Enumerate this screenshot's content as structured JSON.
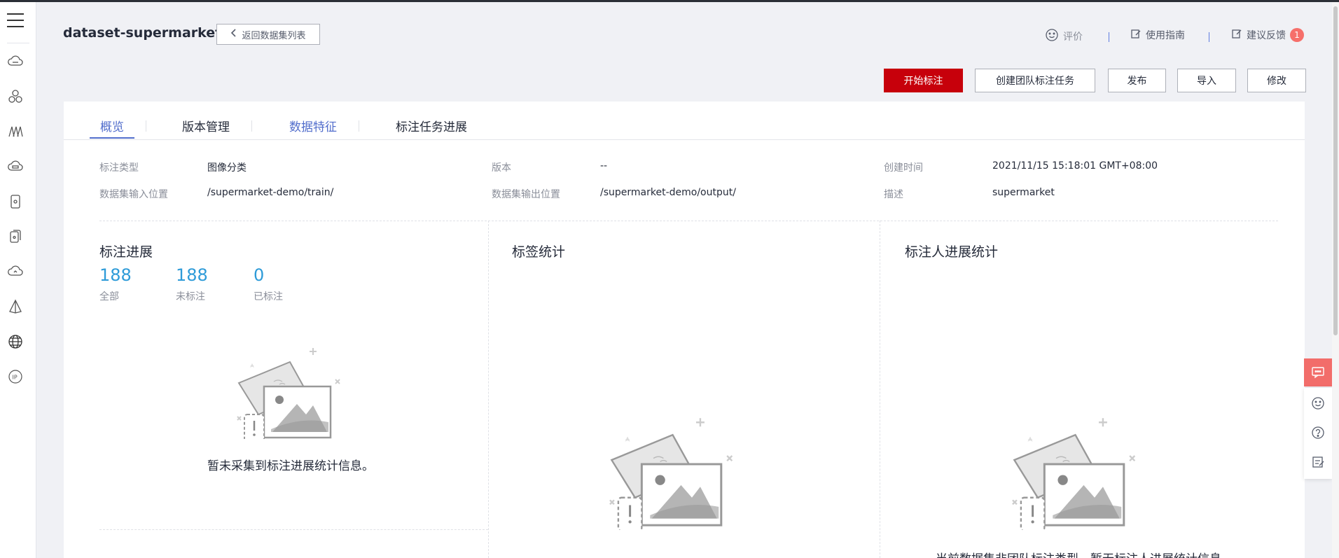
{
  "header": {
    "title": "dataset-supermarket",
    "back_label": "返回数据集列表",
    "rate_label": "评价",
    "guide_label": "使用指南",
    "feedback_label": "建议反馈",
    "feedback_count": "1"
  },
  "actions": {
    "start_label": "开始标注",
    "team_label": "创建团队标注任务",
    "publish_label": "发布",
    "import_label": "导入",
    "edit_label": "修改"
  },
  "tabs": [
    {
      "label": "概览"
    },
    {
      "label": "版本管理"
    },
    {
      "label": "数据特征"
    },
    {
      "label": "标注任务进展"
    }
  ],
  "info": {
    "type_label": "标注类型",
    "type_value": "图像分类",
    "version_label": "版本",
    "version_value": "--",
    "created_label": "创建时间",
    "created_value": "2021/11/15 15:18:01 GMT+08:00",
    "input_label": "数据集输入位置",
    "input_value": "/supermarket-demo/train/",
    "output_label": "数据集输出位置",
    "output_value": "/supermarket-demo/output/",
    "desc_label": "描述",
    "desc_value": "supermarket"
  },
  "progress": {
    "title": "标注进展",
    "stats": [
      {
        "value": "188",
        "label": "全部"
      },
      {
        "value": "188",
        "label": "未标注"
      },
      {
        "value": "0",
        "label": "已标注"
      }
    ],
    "empty_text": "暂未采集到标注进展统计信息。"
  },
  "labels_section": {
    "title": "标签统计"
  },
  "annotator_section": {
    "title": "标注人进展统计",
    "empty_text": "当前数据集非团队标注类型，暂无标注人进展统计信息"
  },
  "colors": {
    "brand_red": "#c7000b",
    "accent_blue": "#526ecc",
    "stat_blue": "#2e9bd8"
  }
}
